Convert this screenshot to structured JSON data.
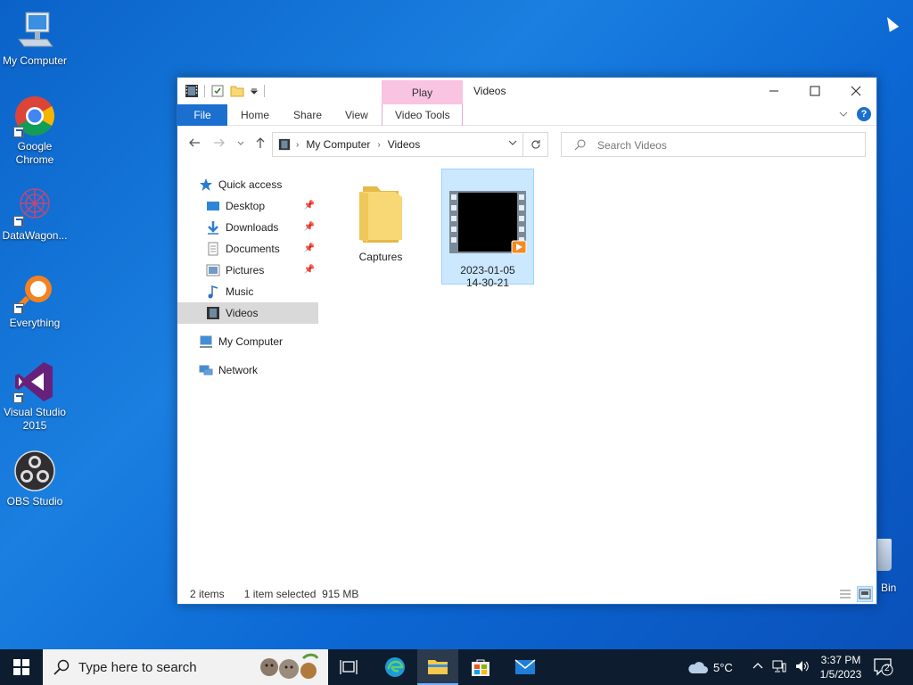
{
  "desktop": {
    "icons": [
      {
        "label": "My Computer"
      },
      {
        "label": "Google Chrome"
      },
      {
        "label": "DataWagon..."
      },
      {
        "label": "Everything"
      },
      {
        "label": "Visual Studio 2015"
      },
      {
        "label": "OBS Studio"
      }
    ],
    "recycle_bin_label": "Bin"
  },
  "window": {
    "title": "Videos",
    "context_tab": "Play",
    "ribbon_tabs": [
      "File",
      "Home",
      "Share",
      "View",
      "Video Tools"
    ],
    "address": {
      "crumbs": [
        "My Computer",
        "Videos"
      ]
    },
    "search_placeholder": "Search Videos",
    "nav": {
      "quick_access": "Quick access",
      "pinned": [
        "Desktop",
        "Downloads",
        "Documents",
        "Pictures"
      ],
      "unpinned": [
        "Music",
        "Videos"
      ],
      "selected": "Videos",
      "my_computer": "My Computer",
      "network": "Network"
    },
    "items": [
      {
        "name": "Captures",
        "type": "folder"
      },
      {
        "name_line1": "2023-01-05",
        "name_line2": "14-30-21",
        "type": "video",
        "selected": true
      }
    ],
    "status": {
      "count": "2 items",
      "selection": "1 item selected  915 MB"
    }
  },
  "taskbar": {
    "search_text": "Type here to search",
    "weather": "5°C",
    "time": "3:37 PM",
    "date": "1/5/2023",
    "notifications": "2"
  },
  "colors": {
    "accent": "#1a6fcf",
    "context_tab": "#f9c3e2",
    "selection": "#cce8ff",
    "taskbar": "#0d1c2e"
  }
}
